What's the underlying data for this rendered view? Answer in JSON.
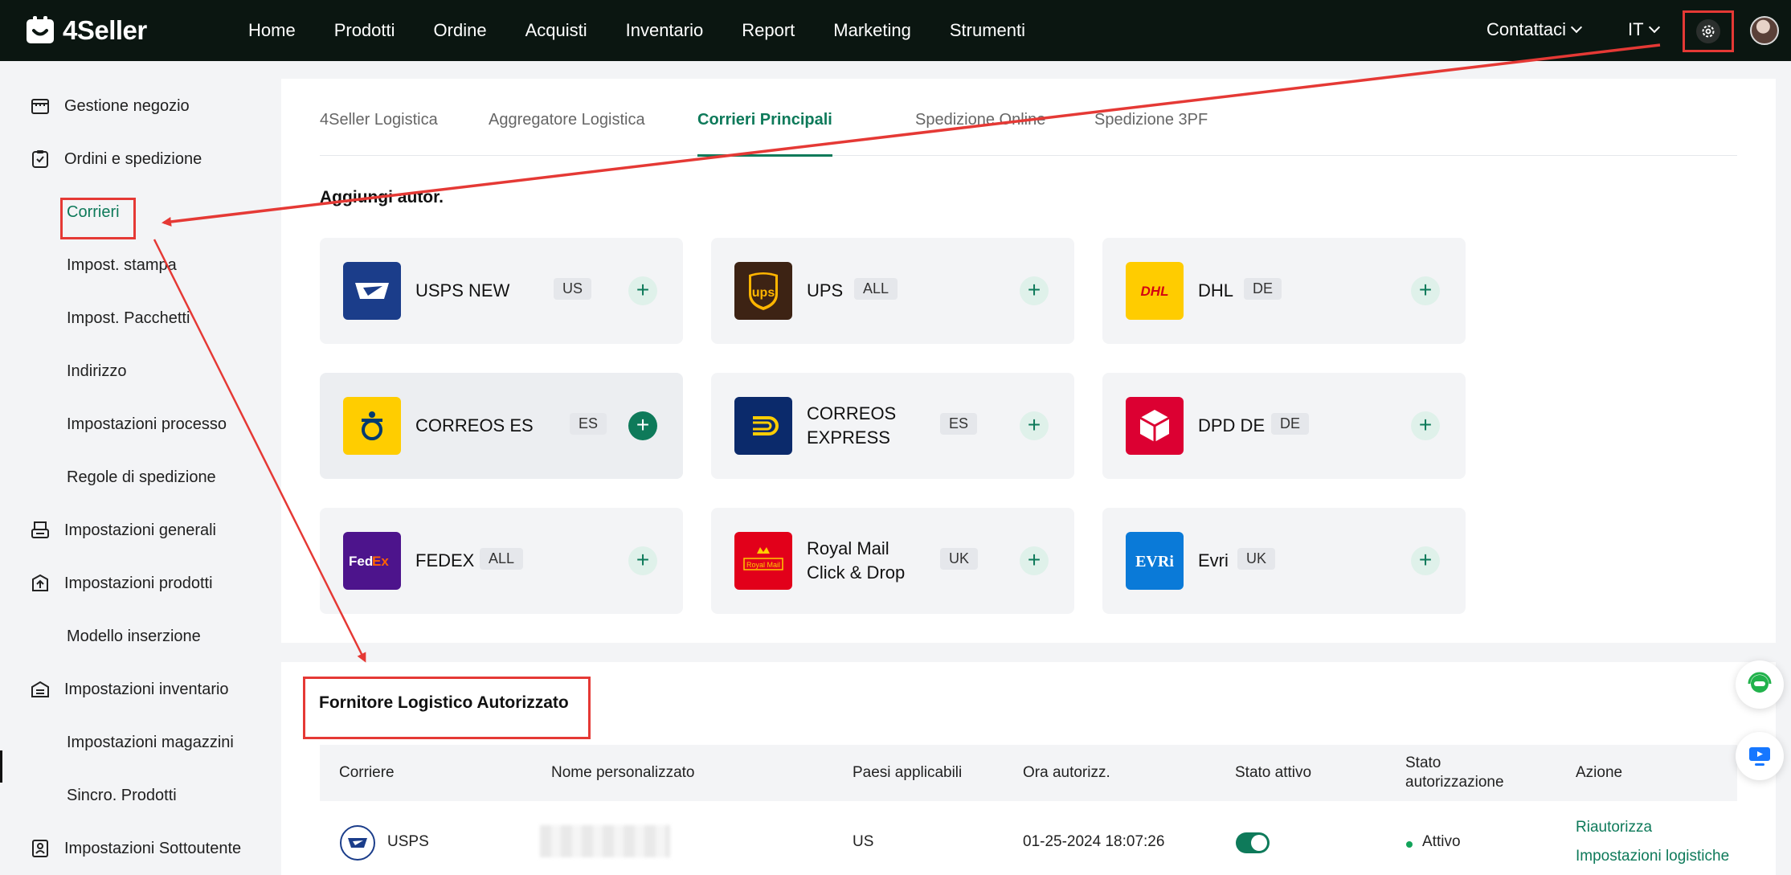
{
  "app": {
    "logo_text": "4Seller"
  },
  "topnav": {
    "items": [
      "Home",
      "Prodotti",
      "Ordine",
      "Acquisti",
      "Inventario",
      "Report",
      "Marketing",
      "Strumenti"
    ],
    "contact_label": "Contattaci",
    "language": "IT"
  },
  "sidebar": {
    "items": [
      {
        "label": "Gestione negozio",
        "icon": "store-icon"
      },
      {
        "label": "Ordini e spedizione",
        "icon": "clipboard-check-icon"
      },
      {
        "label": "Corrieri",
        "active": true
      },
      {
        "label": "Impost. stampa"
      },
      {
        "label": "Impost. Pacchetti"
      },
      {
        "label": "Indirizzo"
      },
      {
        "label": "Impostazioni processo"
      },
      {
        "label": "Regole di spedizione"
      },
      {
        "label": "Impostazioni generali",
        "icon": "printer-icon"
      },
      {
        "label": "Impostazioni prodotti",
        "icon": "box-upload-icon"
      },
      {
        "label": "Modello inserzione"
      },
      {
        "label": "Impostazioni inventario",
        "icon": "warehouse-icon"
      },
      {
        "label": "Impostazioni magazzini"
      },
      {
        "label": "Sincro. Prodotti"
      },
      {
        "label": "Impostazioni Sottoutente",
        "icon": "user-badge-icon"
      }
    ]
  },
  "tabs": [
    "4Seller Logistica",
    "Aggregatore Logistica",
    "Corrieri Principali",
    "Spedizione Online",
    "Spedizione 3PF"
  ],
  "active_tab": "Corrieri Principali",
  "add_section": {
    "title": "Aggiungi autor.",
    "carriers": [
      {
        "name": "USPS NEW",
        "tag": "US",
        "logo": "usps-eagle-logo",
        "color": "#1b3d8a"
      },
      {
        "name": "UPS",
        "tag": "ALL",
        "logo": "ups-shield-logo",
        "color": "#3d2314"
      },
      {
        "name": "DHL",
        "tag": "DE",
        "logo": "dhl-logo",
        "color": "#ffcc00"
      },
      {
        "name": "CORREOS ES",
        "tag": "ES",
        "logo": "correos-horn-logo",
        "color": "#ffcd00"
      },
      {
        "name": "CORREOS EXPRESS",
        "name_line1": "CORREOS",
        "name_line2": "EXPRESS",
        "tag": "ES",
        "logo": "correos-express-logo",
        "color": "#0b2a6b"
      },
      {
        "name": "DPD DE",
        "tag": "DE",
        "logo": "dpd-cube-logo",
        "color": "#dc0032"
      },
      {
        "name": "FEDEX",
        "tag": "ALL",
        "logo": "fedex-logo",
        "color": "#4d148c"
      },
      {
        "name": "Royal Mail Click & Drop",
        "name_line1": "Royal Mail",
        "name_line2": "Click & Drop",
        "tag": "UK",
        "logo": "royal-mail-logo",
        "color": "#e2001a"
      },
      {
        "name": "Evri",
        "tag": "UK",
        "logo": "evri-logo",
        "color": "#0a7ad8"
      }
    ],
    "logo_texts": {
      "ups": "ups",
      "dhl": "DHL",
      "fedex_fed": "Fed",
      "fedex_ex": "Ex",
      "royal_mail": "Royal Mail",
      "evri": "EVRi"
    }
  },
  "authorized": {
    "title": "Fornitore Logistico Autorizzato",
    "columns": [
      "Corriere",
      "Nome personalizzato",
      "Paesi applicabili",
      "Ora autorizz.",
      "Stato attivo",
      "Stato autorizzazione",
      "Azione"
    ],
    "rows": [
      {
        "carrier": "USPS",
        "custom_name": "",
        "countries": "US",
        "auth_time": "01-25-2024 18:07:26",
        "active": true,
        "status": "Attivo",
        "actions": [
          "Riautorizza",
          "Impostazioni logistiche"
        ]
      }
    ]
  },
  "colors": {
    "accent": "#0e7a5a",
    "nav_bg": "#0b1611",
    "annotation_red": "#e53935"
  }
}
